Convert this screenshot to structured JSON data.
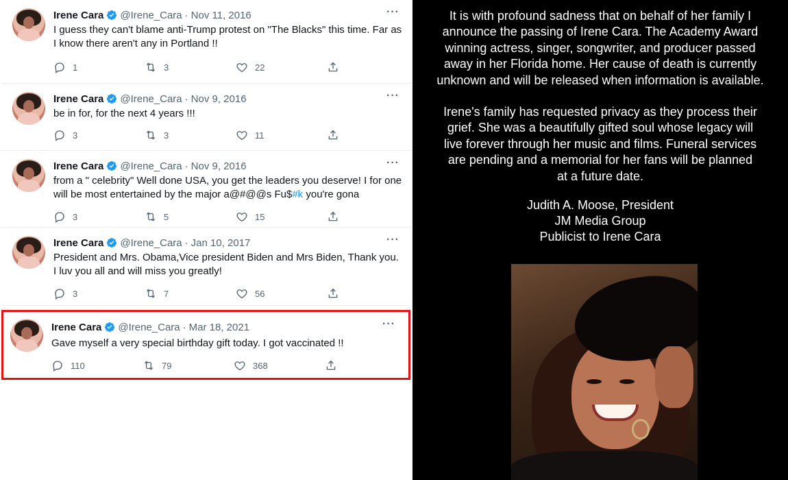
{
  "tweets": [
    {
      "name": "Irene Cara",
      "handle": "@Irene_Cara",
      "date": "Nov 11, 2016",
      "text": "I guess they can't blame anti-Trump protest on \"The Blacks\" this time. Far as I know there aren't any in Portland !!",
      "replies": "1",
      "retweets": "3",
      "likes": "22"
    },
    {
      "name": "Irene Cara",
      "handle": "@Irene_Cara",
      "date": "Nov 9, 2016",
      "text": "be in for, for the next 4 years !!!",
      "replies": "3",
      "retweets": "3",
      "likes": "11"
    },
    {
      "name": "Irene Cara",
      "handle": "@Irene_Cara",
      "date": "Nov 9, 2016",
      "text_before_tag": "from a \" celebrity\" Well done USA, you get the leaders you deserve! I for one will be most entertained by the major a@#@@s Fu$",
      "tag": "#k",
      "text_after_tag": " you're gona",
      "replies": "3",
      "retweets": "5",
      "likes": "15"
    },
    {
      "name": "Irene Cara",
      "handle": "@Irene_Cara",
      "date": "Jan 10, 2017",
      "text": "President and Mrs. Obama,Vice president Biden and Mrs Biden, Thank you. I luv you all and will miss you greatly!",
      "replies": "3",
      "retweets": "7",
      "likes": "56"
    },
    {
      "name": "Irene Cara",
      "handle": "@Irene_Cara",
      "date": "Mar 18, 2021",
      "text": "Gave myself a very special birthday gift today. I got vaccinated !!",
      "replies": "110",
      "retweets": "79",
      "likes": "368"
    }
  ],
  "separator": "·",
  "announcement": {
    "para1": [
      "It is with profound sadness that on behalf of her family I",
      "announce the passing of Irene Cara. The Academy Award",
      "winning actress, singer, songwriter, and producer passed",
      "away in her Florida home. Her cause of death is currently",
      "unknown and will be released when information is available."
    ],
    "para2": [
      "Irene's family has requested privacy as they process their",
      "grief. She was a beautifully gifted soul whose legacy will",
      "live forever through her music and films. Funeral services",
      "are pending and a memorial for her fans will be planned",
      "at a future date."
    ],
    "signature": [
      "Judith A. Moose, President",
      "JM Media Group",
      "Publicist to Irene Cara"
    ]
  },
  "colors": {
    "verified": "#1d9bf0",
    "highlight_border": "#e0131a",
    "announcement_bg": "#000000"
  }
}
